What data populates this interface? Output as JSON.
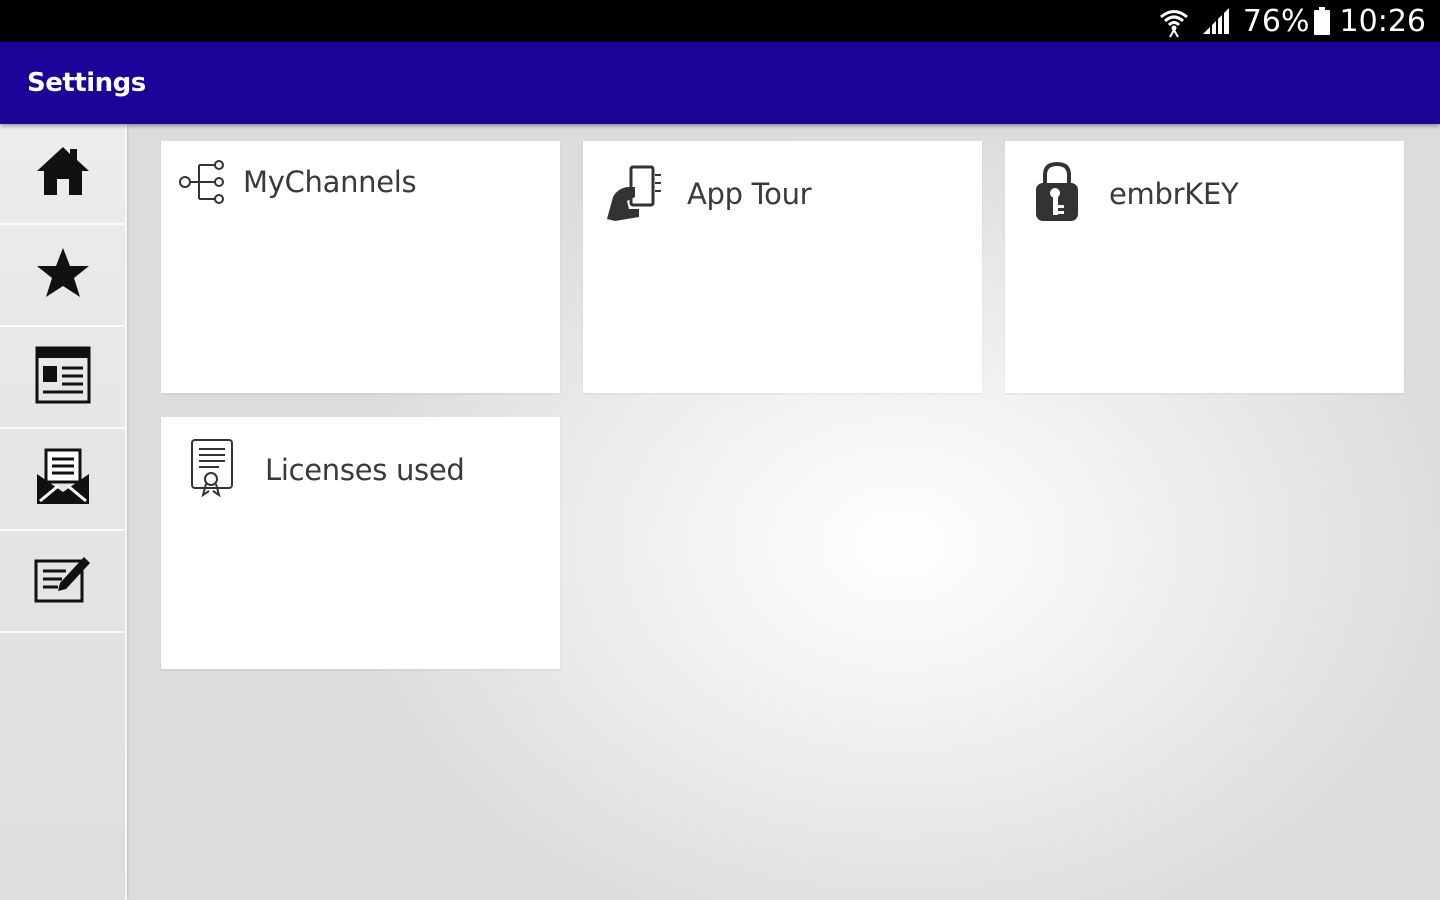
{
  "status_bar": {
    "battery": "76%",
    "time": "10:26",
    "icons": [
      "wifi-icon",
      "signal-icon",
      "battery-icon"
    ]
  },
  "app_bar": {
    "title": "Settings",
    "background_color": "#1c0399"
  },
  "sidebar": {
    "items": [
      {
        "name": "home",
        "icon": "home-icon"
      },
      {
        "name": "favorites",
        "icon": "star-icon"
      },
      {
        "name": "news",
        "icon": "newspaper-icon"
      },
      {
        "name": "messages",
        "icon": "mail-icon"
      },
      {
        "name": "edit",
        "icon": "edit-icon"
      }
    ]
  },
  "tiles": [
    {
      "label": "MyChannels",
      "icon": "channels-icon"
    },
    {
      "label": "App Tour",
      "icon": "app-tour-icon"
    },
    {
      "label": "embrKEY",
      "icon": "lock-key-icon"
    },
    {
      "label": "Licenses used",
      "icon": "certificate-icon"
    }
  ]
}
